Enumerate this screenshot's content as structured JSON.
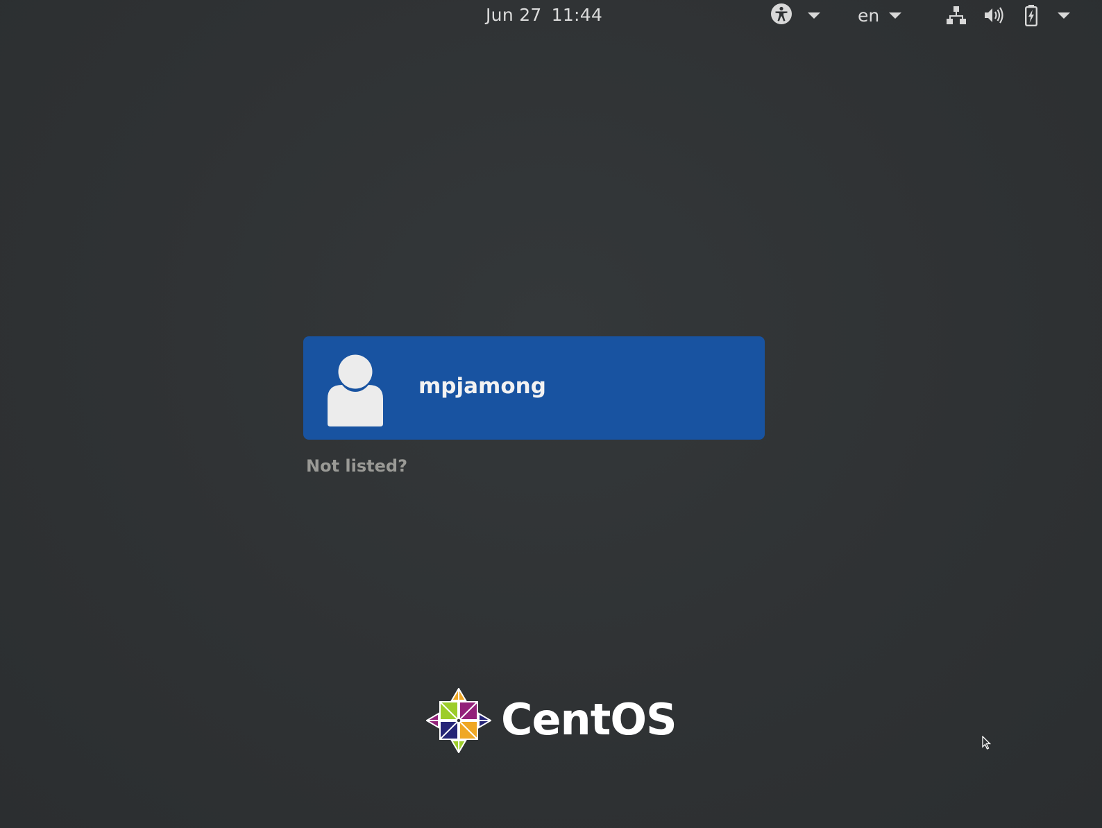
{
  "topbar": {
    "date": "Jun 27",
    "time": "11:44",
    "accessibility_icon": "accessibility-icon",
    "language": "en",
    "network_icon": "network-wired-icon",
    "volume_icon": "volume-icon",
    "battery_icon": "battery-charging-icon"
  },
  "users": [
    {
      "name": "mpjamong",
      "avatar_icon": "user-avatar-icon"
    }
  ],
  "not_listed_label": "Not listed?",
  "logo": {
    "text": "CentOS",
    "colors": {
      "green": "#9ccd2a",
      "purple": "#932279",
      "orange": "#efa724",
      "blue": "#262577"
    }
  },
  "colors": {
    "background": "#2e3133",
    "user_selected": "#1853a1"
  }
}
